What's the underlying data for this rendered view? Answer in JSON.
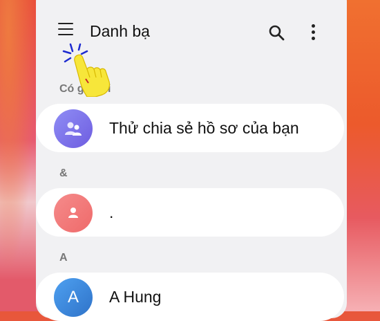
{
  "header": {
    "title": "Danh bạ"
  },
  "sections": [
    {
      "label": "Có gì mới",
      "items": [
        {
          "name": "Thử chia sẻ hồ sơ của bạn",
          "avatar_icon": "profile-share-icon",
          "avatar_color": "#7b6ee8"
        }
      ]
    },
    {
      "label": "&",
      "items": [
        {
          "name": ".",
          "avatar_icon": "person-icon",
          "avatar_color": "#f07474"
        }
      ]
    },
    {
      "label": "A",
      "items": [
        {
          "name": "A Hung",
          "avatar_letter": "A",
          "avatar_color": "#3a85d8"
        }
      ]
    }
  ],
  "overlay": {
    "icon": "tap-hand-pointer-icon",
    "color": "#f7e63a"
  }
}
